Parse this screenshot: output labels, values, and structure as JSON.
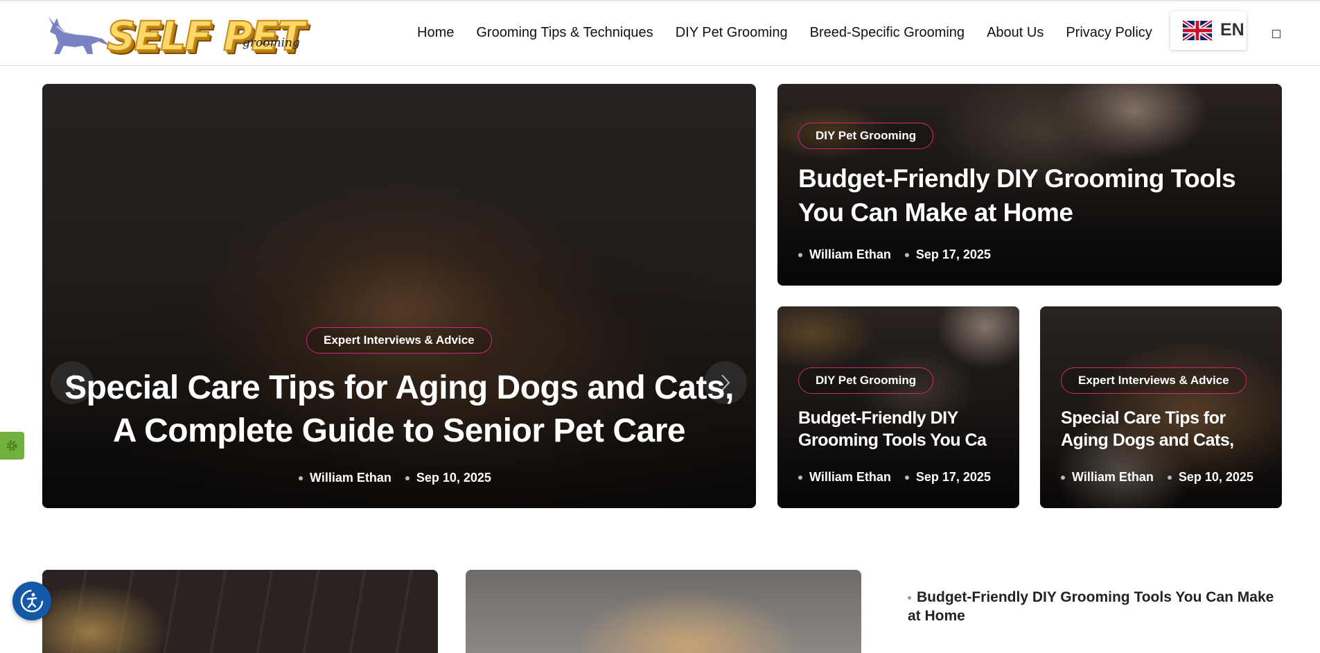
{
  "logo": {
    "text": "SELF PET",
    "subtext": "grooming"
  },
  "nav": {
    "items": [
      "Home",
      "Grooming Tips & Techniques",
      "DIY Pet Grooming",
      "Breed-Specific Grooming",
      "About Us",
      "Privacy Policy"
    ]
  },
  "language": {
    "code": "EN"
  },
  "hero": {
    "badge": "Expert Interviews & Advice",
    "title": "Special Care Tips for Aging Dogs and Cats, A Complete Guide to Senior Pet Care",
    "author": "William Ethan",
    "date": "Sep 10, 2025"
  },
  "card_top": {
    "badge": "DIY Pet Grooming",
    "title": "Budget-Friendly DIY Grooming Tools You Can Make at Home",
    "author": "William Ethan",
    "date": "Sep 17, 2025"
  },
  "card_small_1": {
    "badge": "DIY Pet Grooming",
    "title": "Budget-Friendly DIY Grooming Tools You Ca",
    "author": "William Ethan",
    "date": "Sep 17, 2025"
  },
  "card_small_2": {
    "badge": "Expert Interviews & Advice",
    "title": "Special Care Tips for Aging Dogs and Cats,",
    "author": "William Ethan",
    "date": "Sep 10, 2025"
  },
  "sidebar": {
    "post_title": "Budget-Friendly DIY Grooming Tools You Can Make at Home"
  },
  "colors": {
    "badge_border": "#d1267a",
    "gear_tab": "#71b13d",
    "accessibility_button": "#1458a8"
  }
}
